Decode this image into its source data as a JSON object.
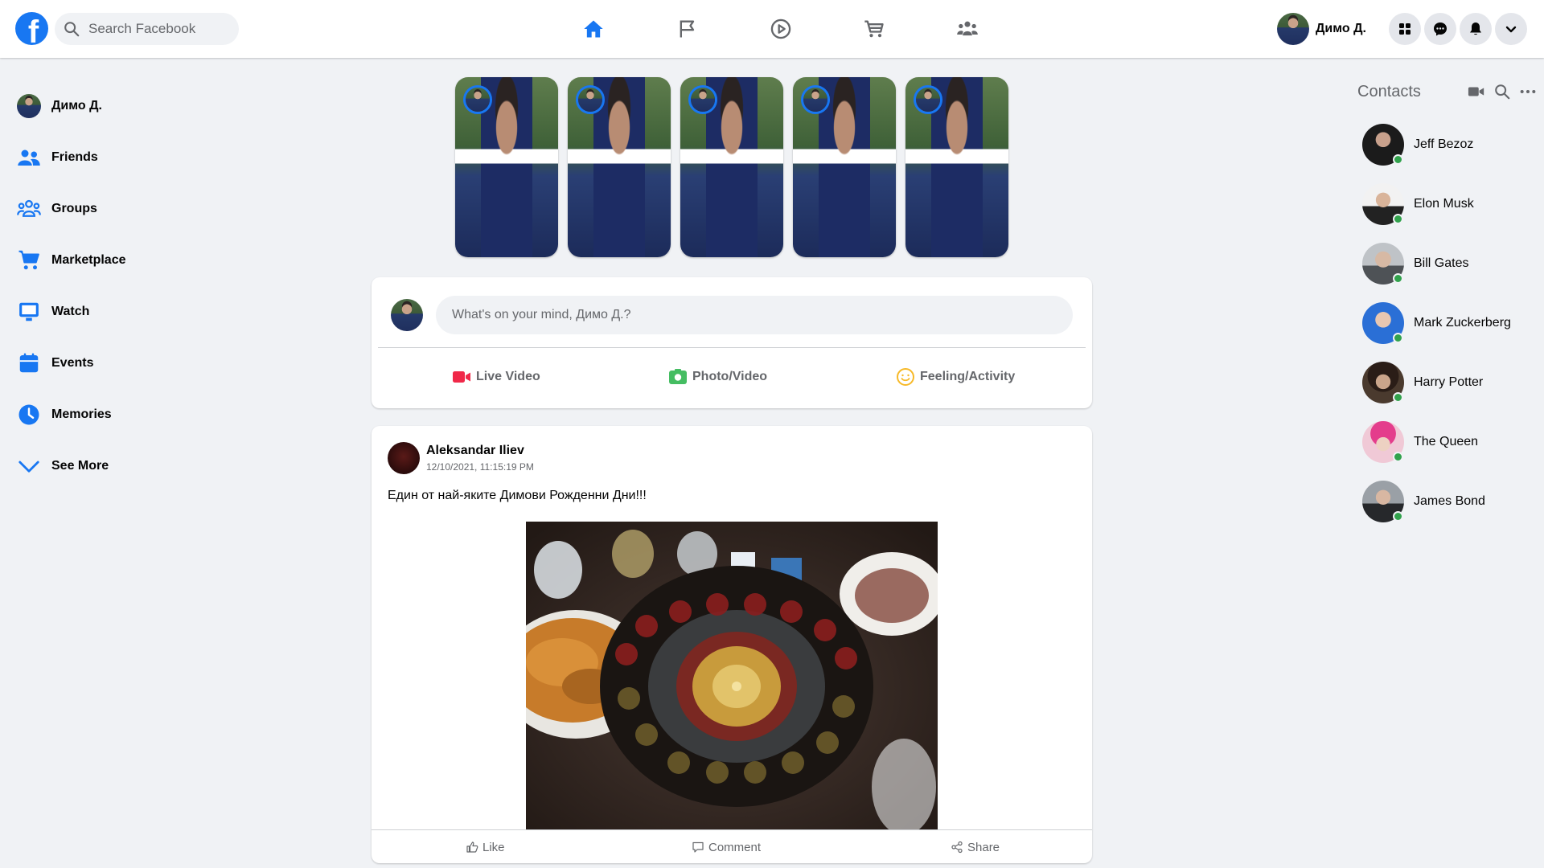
{
  "colors": {
    "brand": "#1877f2",
    "online": "#31a24c",
    "muted_text": "#65676b",
    "live_video": "#f02849",
    "photo_video": "#45bd62",
    "feeling": "#f7b928"
  },
  "topbar": {
    "logo_letter": "f",
    "search_placeholder": "Search Facebook",
    "nav_tabs": [
      "home-icon",
      "flag-icon",
      "watch-icon",
      "marketplace-icon",
      "groups-icon"
    ],
    "active_tab": "home-icon",
    "profile_name": "Димо Д.",
    "action_icons": [
      "menu-icon",
      "messenger-icon",
      "notifications-icon",
      "account-chevron-icon"
    ]
  },
  "sidebar": {
    "items": [
      {
        "label": "Димо Д.",
        "icon": "profile-avatar"
      },
      {
        "label": "Friends",
        "icon": "friends-icon"
      },
      {
        "label": "Groups",
        "icon": "groups-icon"
      },
      {
        "label": "Marketplace",
        "icon": "cart-icon"
      },
      {
        "label": "Watch",
        "icon": "monitor-icon"
      },
      {
        "label": "Events",
        "icon": "calendar-icon"
      },
      {
        "label": "Memories",
        "icon": "clock-icon"
      },
      {
        "label": "See More",
        "icon": "chevron-down-icon"
      }
    ]
  },
  "stories": {
    "count": 5
  },
  "composer": {
    "placeholder": "What's on your mind, Димо Д.?",
    "actions": [
      {
        "label": "Live Video",
        "icon": "live-video-icon"
      },
      {
        "label": "Photo/Video",
        "icon": "photo-icon"
      },
      {
        "label": "Feeling/Activity",
        "icon": "smile-icon"
      }
    ]
  },
  "post": {
    "author": "Aleksandar Iliev",
    "timestamp": "12/10/2021, 11:15:19 PM",
    "text": "Един от най-яките Димови Рожденни Дни!!!",
    "actions": [
      {
        "label": "Like",
        "icon": "like-icon"
      },
      {
        "label": "Comment",
        "icon": "comment-icon"
      },
      {
        "label": "Share",
        "icon": "share-icon"
      }
    ]
  },
  "contacts": {
    "title": "Contacts",
    "header_icons": [
      "video-call-icon",
      "search-icon",
      "more-icon"
    ],
    "list": [
      {
        "name": "Jeff Bezoz",
        "online": true
      },
      {
        "name": "Elon Musk",
        "online": true
      },
      {
        "name": "Bill Gates",
        "online": true
      },
      {
        "name": "Mark Zuckerberg",
        "online": true
      },
      {
        "name": "Harry Potter",
        "online": true
      },
      {
        "name": "The Queen",
        "online": true
      },
      {
        "name": "James Bond",
        "online": true
      }
    ]
  }
}
